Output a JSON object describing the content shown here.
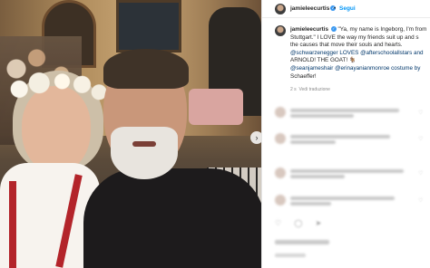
{
  "post": {
    "username": "jamieleecurtis",
    "verified_badge": "✓",
    "separator": "•",
    "follow_label": "Segui"
  },
  "caption": {
    "username": "jamieleecurtis",
    "line1": "\"Ya, my name is Ingeborg, I'm from",
    "line2": "Stuttgart.\" I LOVE the way my friends suit up and s",
    "line3": "the causes that move their souls and hearts.",
    "line4": "@schwarzenegger LOVES @afterschoolallstars and",
    "line5": "ARNOLD! THE GOAT! 🐐",
    "line6": "@seanjameshair @erinayanianmonroe costume by",
    "line7": "Schaeffer!",
    "meta_time": "2 s",
    "meta_translation": "Vedi traduzione"
  },
  "photo": {
    "next_arrow": "›"
  },
  "actions": {
    "icons": "♡ ◯ ➤"
  },
  "icons": [
    "verified-badge-icon",
    "heart-icon",
    "chevron-right-icon"
  ]
}
